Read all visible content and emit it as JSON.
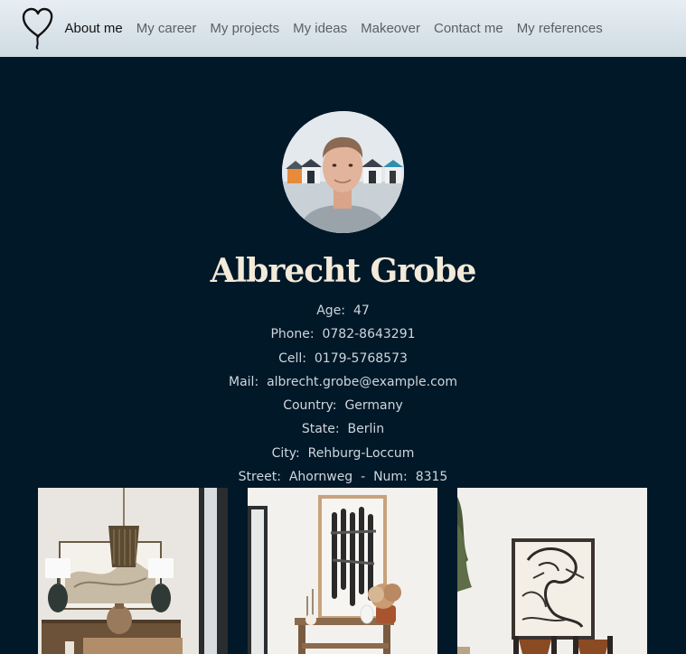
{
  "nav": {
    "items": [
      {
        "label": "About me"
      },
      {
        "label": "My career"
      },
      {
        "label": "My projects"
      },
      {
        "label": "My ideas"
      },
      {
        "label": "Makeover"
      },
      {
        "label": "Contact me"
      },
      {
        "label": "My references"
      }
    ],
    "logo_icon": "heart-balloon-icon"
  },
  "profile": {
    "name": "Albrecht Grobe",
    "age_label": "Age:",
    "age": "47",
    "phone_label": "Phone:",
    "phone": "0782-8643291",
    "cell_label": "Cell:",
    "cell": "0179-5768573",
    "mail_label": "Mail:",
    "mail": "albrecht.grobe@example.com",
    "country_label": "Country:",
    "country": "Germany",
    "state_label": "State:",
    "state": "Berlin",
    "city_label": "City:",
    "city": "Rehburg-Loccum",
    "street_label": "Street:",
    "street": "Ahornweg",
    "num_sep": "-",
    "num_label": "Num:",
    "num": "8315"
  },
  "colors": {
    "background": "#001828",
    "name": "#f3ead9",
    "text": "#cfd6dc",
    "nav_active": "#111111",
    "nav_inactive": "#5b6168"
  }
}
